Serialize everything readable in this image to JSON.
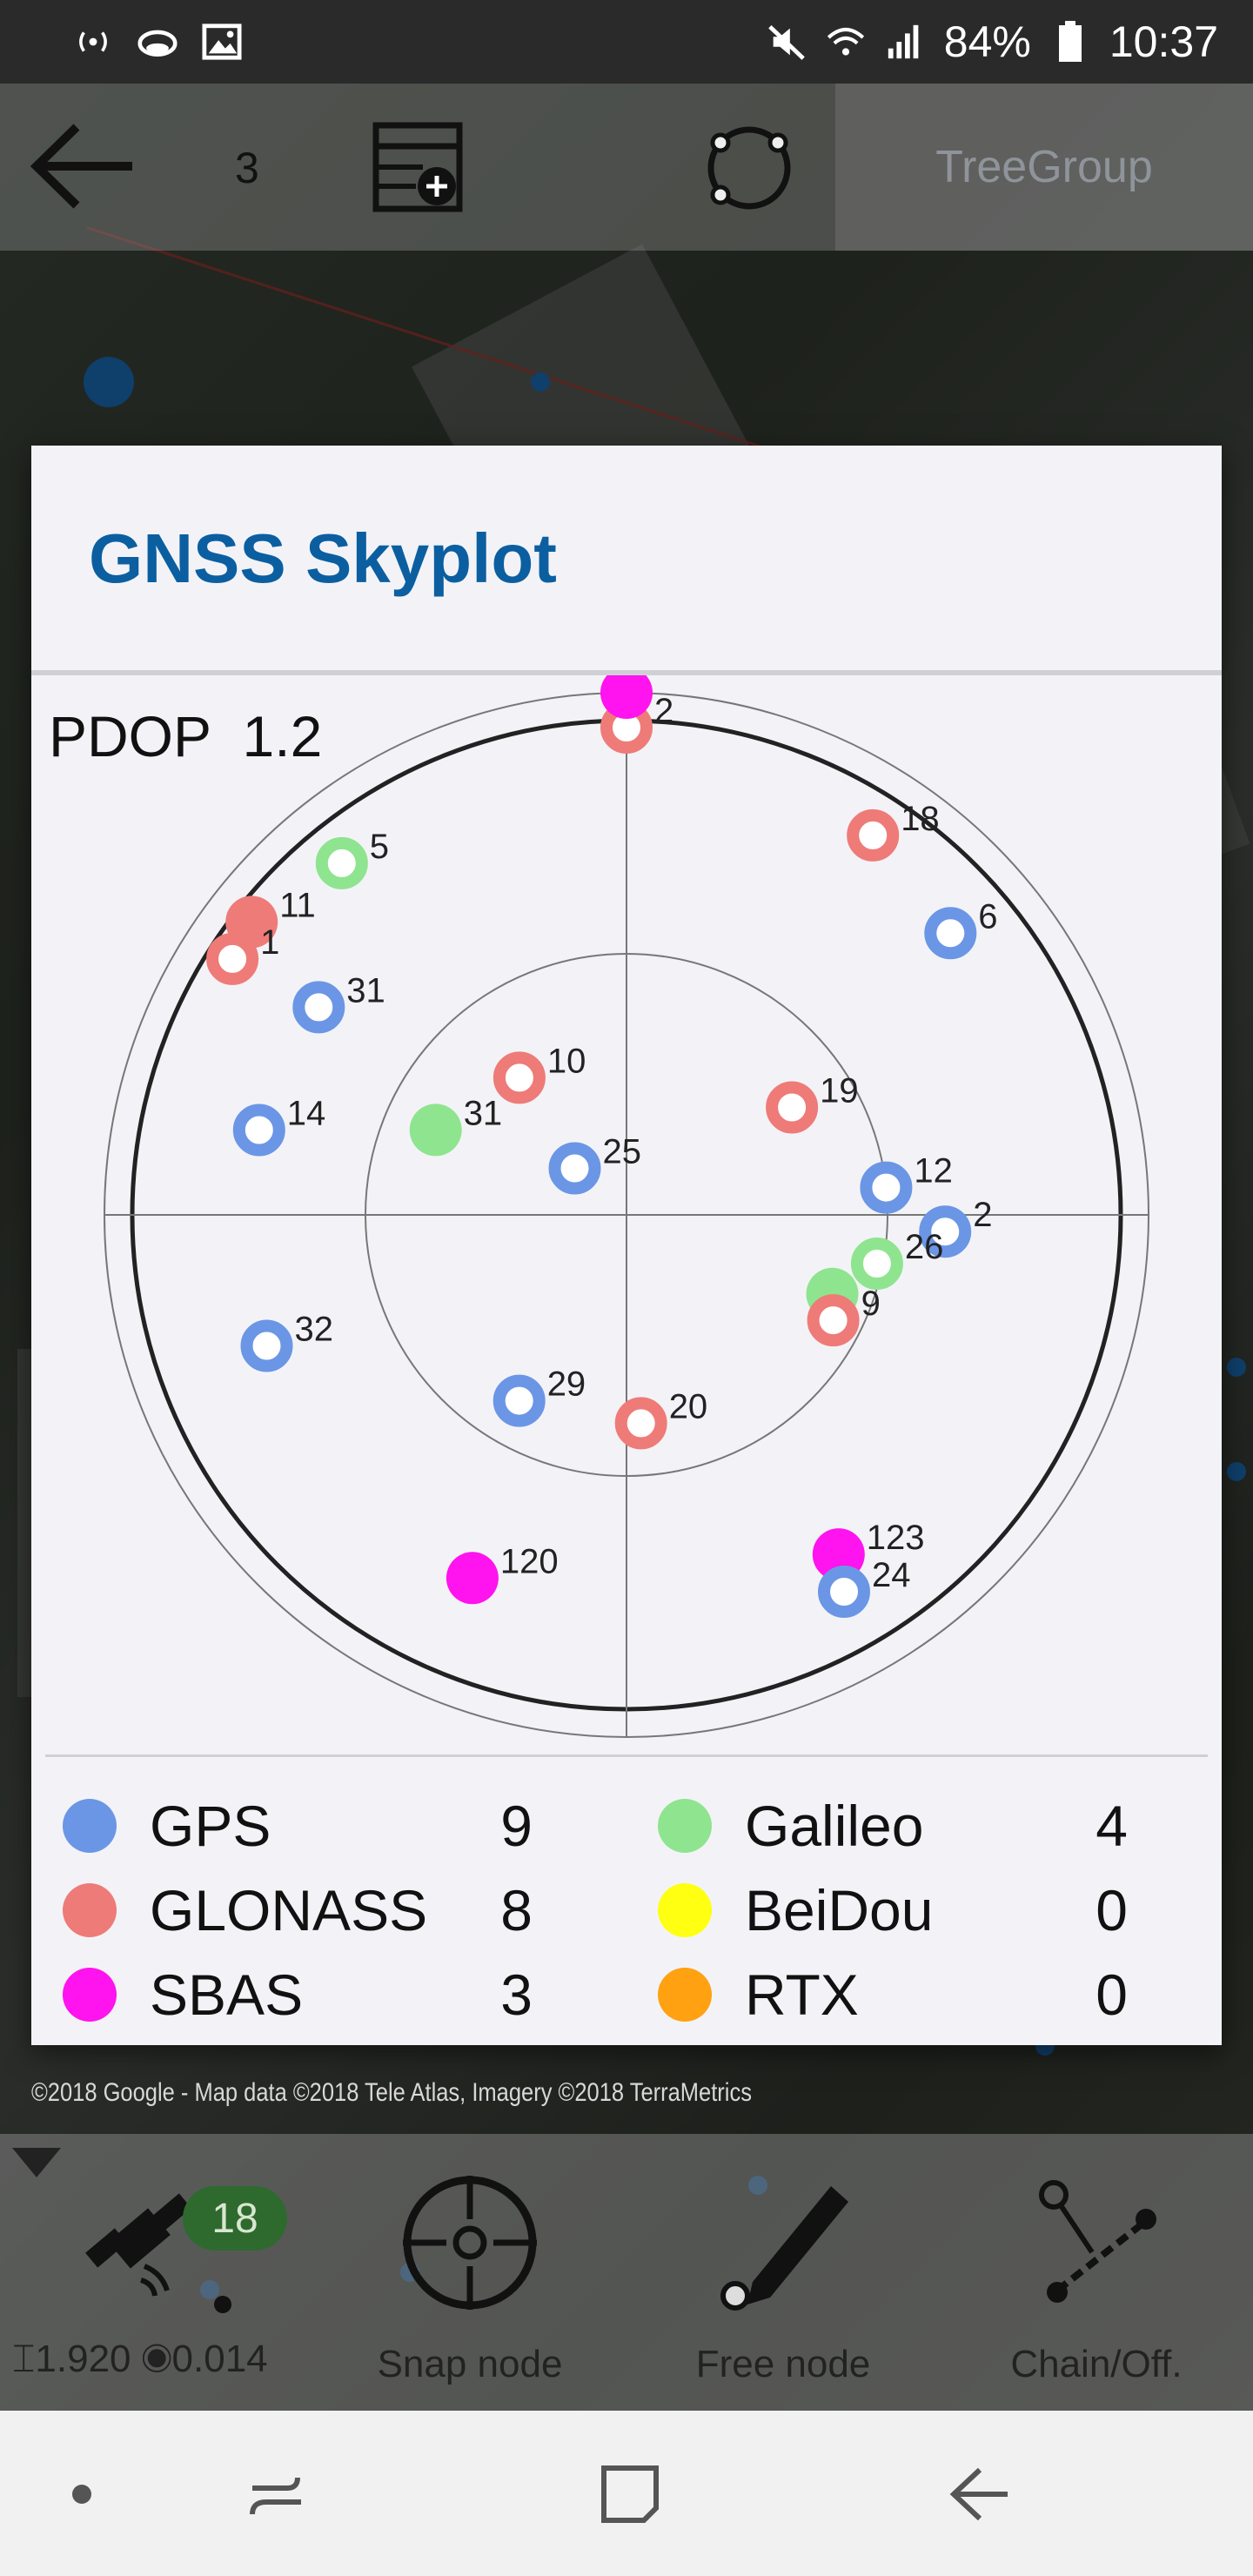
{
  "status_bar": {
    "battery": "84%",
    "time": "10:37"
  },
  "toolbar": {
    "count": "3",
    "group": "TreeGroup"
  },
  "dialog": {
    "title": "GNSS Skyplot",
    "pdop_label": "PDOP",
    "pdop_value": "1.2",
    "satellites": [
      {
        "id": "2",
        "system": "GLONASS",
        "az": 0,
        "el": 6,
        "filled": false
      },
      {
        "id": "",
        "system": "SBAS",
        "az": 0,
        "el": 0,
        "filled": true
      },
      {
        "id": "18",
        "system": "GLONASS",
        "az": 33,
        "el": 12,
        "filled": false
      },
      {
        "id": "6",
        "system": "GPS",
        "az": 49,
        "el": 16,
        "filled": false
      },
      {
        "id": "5",
        "system": "Galileo",
        "az": 321,
        "el": 12,
        "filled": false
      },
      {
        "id": "11",
        "system": "GLONASS",
        "az": 308,
        "el": 8,
        "filled": true
      },
      {
        "id": "1",
        "system": "GLONASS",
        "az": 303,
        "el": 9,
        "filled": false
      },
      {
        "id": "31",
        "system": "GPS",
        "az": 304,
        "el": 26,
        "filled": false
      },
      {
        "id": "10",
        "system": "GLONASS",
        "az": 322,
        "el": 60,
        "filled": false
      },
      {
        "id": "31",
        "system": "Galileo",
        "az": 294,
        "el": 54,
        "filled": true
      },
      {
        "id": "19",
        "system": "GLONASS",
        "az": 57,
        "el": 56,
        "filled": false
      },
      {
        "id": "14",
        "system": "GPS",
        "az": 283,
        "el": 25,
        "filled": false
      },
      {
        "id": "25",
        "system": "GPS",
        "az": 312,
        "el": 78,
        "filled": false
      },
      {
        "id": "12",
        "system": "GPS",
        "az": 84,
        "el": 45,
        "filled": false
      },
      {
        "id": "2",
        "system": "GPS",
        "az": 93,
        "el": 35,
        "filled": false
      },
      {
        "id": "26",
        "system": "Galileo",
        "az": 101,
        "el": 46,
        "filled": false
      },
      {
        "id": "",
        "system": "Galileo",
        "az": 111,
        "el": 52,
        "filled": true
      },
      {
        "id": "9",
        "system": "GLONASS",
        "az": 117,
        "el": 50,
        "filled": false
      },
      {
        "id": "32",
        "system": "GPS",
        "az": 250,
        "el": 24,
        "filled": false
      },
      {
        "id": "29",
        "system": "GPS",
        "az": 210,
        "el": 53,
        "filled": false
      },
      {
        "id": "20",
        "system": "GLONASS",
        "az": 176,
        "el": 54,
        "filled": false
      },
      {
        "id": "120",
        "system": "SBAS",
        "az": 203,
        "el": 22,
        "filled": true
      },
      {
        "id": "123",
        "system": "SBAS",
        "az": 148,
        "el": 21,
        "filled": true
      },
      {
        "id": "24",
        "system": "GPS",
        "az": 150,
        "el": 15,
        "filled": false
      }
    ],
    "legend": [
      {
        "name": "GPS",
        "count": "9",
        "color": "#6b96e6"
      },
      {
        "name": "GLONASS",
        "count": "8",
        "color": "#ee7b78"
      },
      {
        "name": "SBAS",
        "count": "3",
        "color": "#ff13ee"
      },
      {
        "name": "Galileo",
        "count": "4",
        "color": "#8fe48f"
      },
      {
        "name": "BeiDou",
        "count": "0",
        "color": "#ffff12"
      },
      {
        "name": "RTX",
        "count": "0",
        "color": "#ffa111"
      }
    ]
  },
  "map": {
    "attribution": "©2018 Google - Map data ©2018 Tele Atlas, Imagery ©2018 TerraMetrics",
    "scale": "50 m"
  },
  "tools": {
    "gnss_count": "18",
    "gnss_vals": "⌶1.920  ◉0.014",
    "snap_node": "Snap node",
    "free_node": "Free node",
    "chain_off": "Chain/Off."
  }
}
